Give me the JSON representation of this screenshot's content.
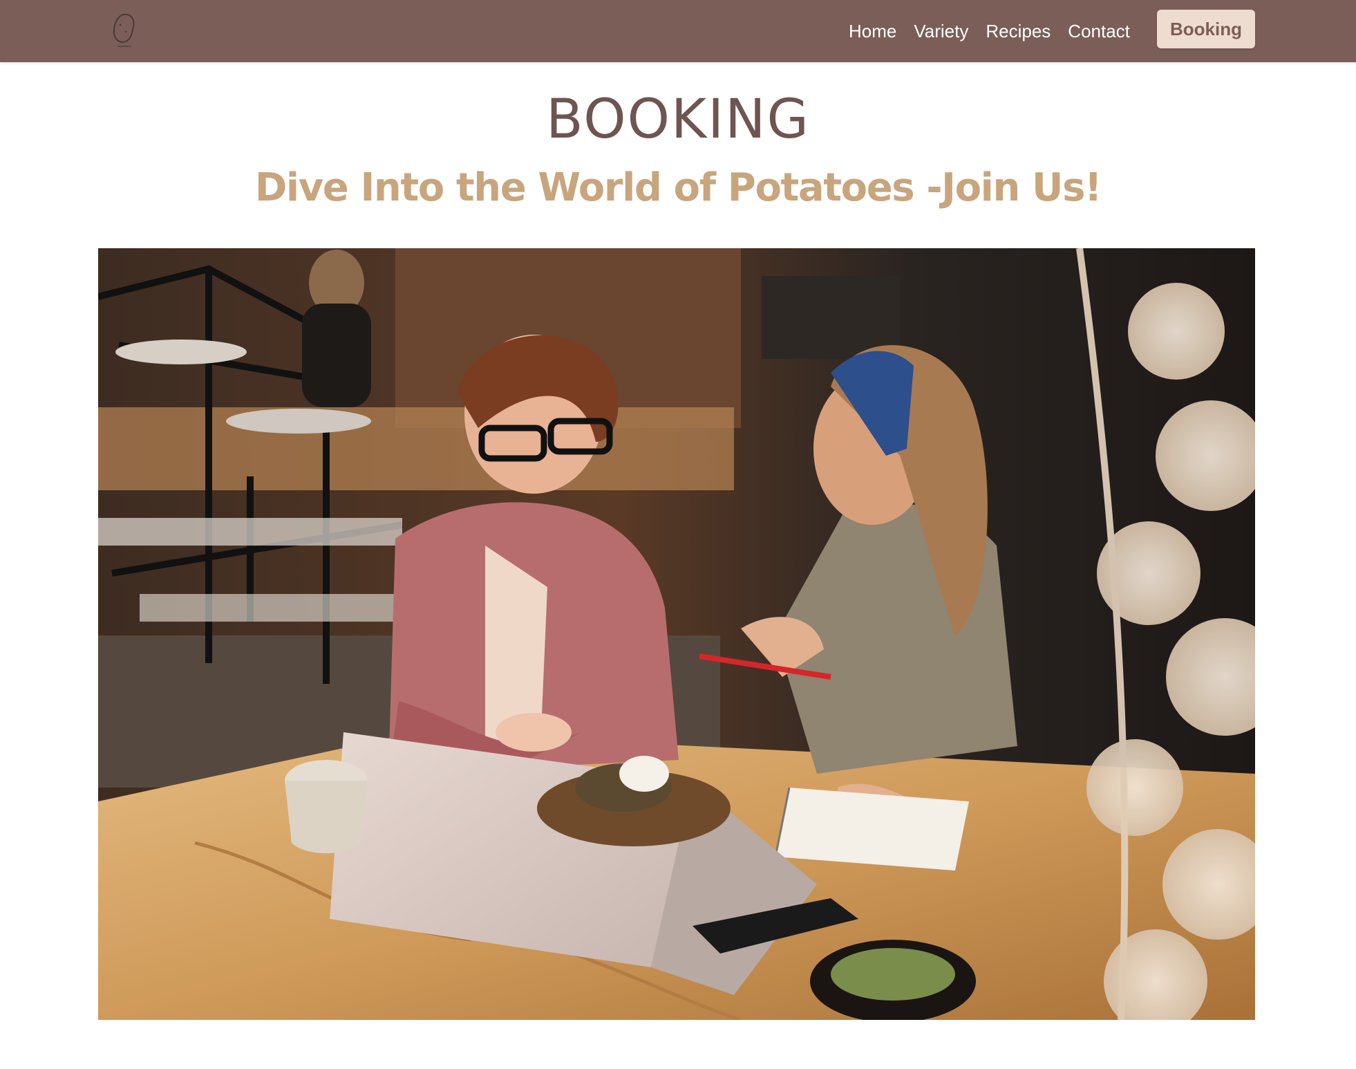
{
  "navbar": {
    "background": "#7a5e57",
    "logo_icon": "potato-logo-icon",
    "links": [
      {
        "label": "Home"
      },
      {
        "label": "Variety"
      },
      {
        "label": "Recipes"
      },
      {
        "label": "Contact"
      }
    ],
    "cta_label": "Booking",
    "cta_background": "#efdcd1"
  },
  "hero": {
    "title": "BOOKING",
    "title_color": "#6e5551",
    "subtitle": "Dive Into the World of Potatoes -Join Us!",
    "subtitle_color": "#c8a57d"
  },
  "image": {
    "subject": "photo-two-women-talking-at-cafe-table"
  }
}
